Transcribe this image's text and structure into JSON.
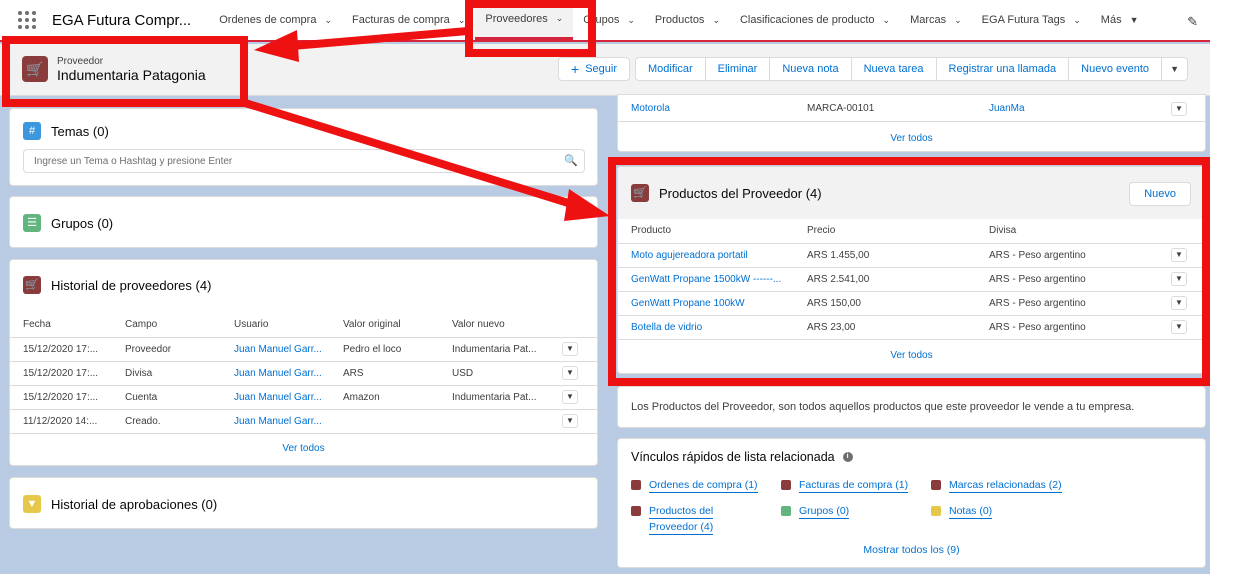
{
  "nav": {
    "app_name": "EGA Futura Compr...",
    "items": [
      {
        "label": "Ordenes de compra",
        "active": false
      },
      {
        "label": "Facturas de compra",
        "active": false
      },
      {
        "label": "Proveedores",
        "active": true
      },
      {
        "label": "Grupos",
        "active": false
      },
      {
        "label": "Productos",
        "active": false
      },
      {
        "label": "Clasificaciones de producto",
        "active": false
      },
      {
        "label": "Marcas",
        "active": false
      },
      {
        "label": "EGA Futura Tags",
        "active": false
      },
      {
        "label": "Más",
        "active": false
      }
    ]
  },
  "record": {
    "type": "Proveedor",
    "name": "Indumentaria Patagonia",
    "actions": [
      "Seguir",
      "Modificar",
      "Eliminar",
      "Nueva nota",
      "Nueva tarea",
      "Registrar una llamada",
      "Nuevo evento"
    ]
  },
  "temas": {
    "title": "Temas (0)",
    "placeholder": "Ingrese un Tema o Hashtag y presione Enter"
  },
  "grupos": {
    "title": "Grupos (0)"
  },
  "historial": {
    "title": "Historial de proveedores (4)",
    "columns": [
      "Fecha",
      "Campo",
      "Usuario",
      "Valor original",
      "Valor nuevo"
    ],
    "rows": [
      [
        "15/12/2020 17:...",
        "Proveedor",
        "Juan Manuel Garr...",
        "Pedro el loco",
        "Indumentaria Pat..."
      ],
      [
        "15/12/2020 17:...",
        "Divisa",
        "Juan Manuel Garr...",
        "ARS",
        "USD"
      ],
      [
        "15/12/2020 17:...",
        "Cuenta",
        "Juan Manuel Garr...",
        "Amazon",
        "Indumentaria Pat..."
      ],
      [
        "11/12/2020 14:...",
        "Creado.",
        "Juan Manuel Garr...",
        "",
        ""
      ]
    ],
    "ver_todos": "Ver todos"
  },
  "aprobaciones": {
    "title": "Historial de aprobaciones (0)"
  },
  "marcas_partial": {
    "row": [
      "Motorola",
      "MARCA-00101",
      "JuanMa"
    ],
    "ver_todos": "Ver todos"
  },
  "productos": {
    "title": "Productos del Proveedor (4)",
    "new_label": "Nuevo",
    "columns": [
      "Producto",
      "Precio",
      "Divisa"
    ],
    "rows": [
      [
        "Moto agujereadora portatil",
        "ARS 1.455,00",
        "ARS - Peso argentino"
      ],
      [
        "GenWatt Propane 1500kW ------...",
        "ARS 2.541,00",
        "ARS - Peso argentino"
      ],
      [
        "GenWatt Propane 100kW",
        "ARS 150,00",
        "ARS - Peso argentino"
      ],
      [
        "Botella de vidrio",
        "ARS 23,00",
        "ARS - Peso argentino"
      ]
    ],
    "ver_todos": "Ver todos"
  },
  "description": "Los Productos del Proveedor, son todos aquellos productos que este proveedor le vende a tu empresa.",
  "quicklinks": {
    "title": "Vínculos rápidos de lista relacionada",
    "links": [
      {
        "label": "Ordenes de compra (1)",
        "color": "#8a3b3b"
      },
      {
        "label": "Facturas de compra (1)",
        "color": "#8a3b3b"
      },
      {
        "label": "Marcas relacionadas (2)",
        "color": "#8a3b3b"
      },
      {
        "label": "Productos del",
        "label2": "Proveedor (4)",
        "color": "#8a3b3b"
      },
      {
        "label": "Grupos (0)",
        "color": "#62b57e"
      },
      {
        "label": "Notas (0)",
        "color": "#e5c84a"
      }
    ],
    "show_all": "Mostrar todos los (9)"
  },
  "colors": {
    "accent": "#d6243d",
    "link": "#0070d2",
    "annotation": "#ee1111"
  }
}
